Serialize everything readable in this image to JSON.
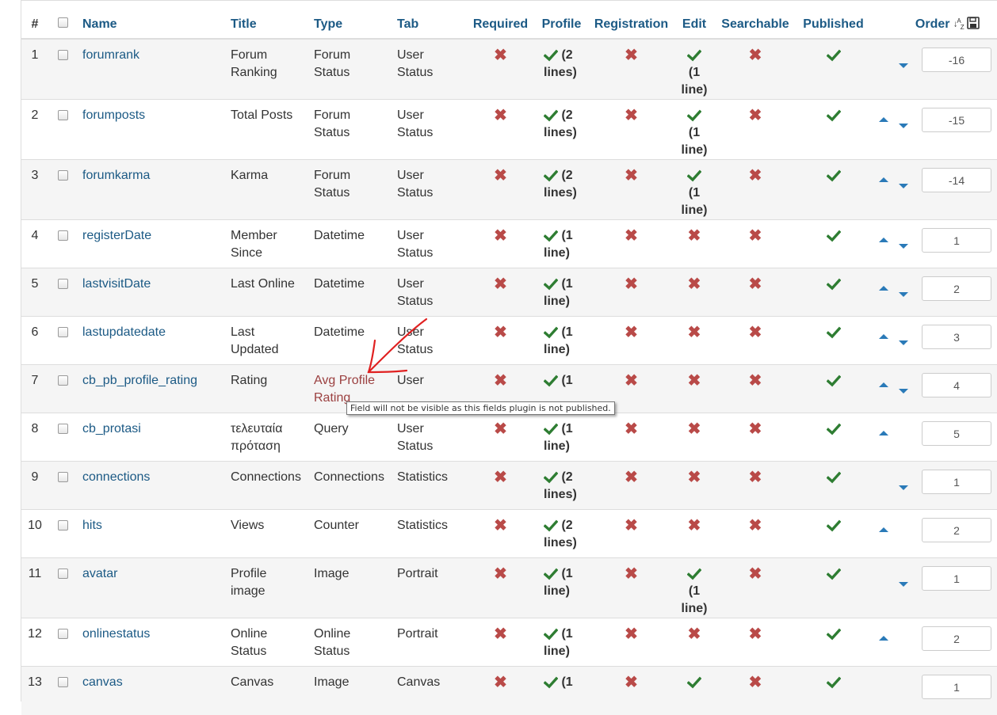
{
  "header": {
    "num": "#",
    "name": "Name",
    "title": "Title",
    "type": "Type",
    "tab": "Tab",
    "required": "Required",
    "profile": "Profile",
    "registration": "Registration",
    "edit": "Edit",
    "searchable": "Searchable",
    "published": "Published",
    "order": "Order",
    "sort_icon": "↓A-Z",
    "save_icon": "save-icon"
  },
  "rows": [
    {
      "num": "1",
      "name": "forumrank",
      "title": "Forum Ranking",
      "type": "Forum Status",
      "tab": "User Status",
      "required": false,
      "profile": "(2 lines)",
      "registration": false,
      "edit": "(1 line)",
      "searchable": false,
      "published": true,
      "up": false,
      "down": true,
      "order": "-16"
    },
    {
      "num": "2",
      "name": "forumposts",
      "title": "Total Posts",
      "type": "Forum Status",
      "tab": "User Status",
      "required": false,
      "profile": "(2 lines)",
      "registration": false,
      "edit": "(1 line)",
      "searchable": false,
      "published": true,
      "up": true,
      "down": true,
      "order": "-15"
    },
    {
      "num": "3",
      "name": "forumkarma",
      "title": "Karma",
      "type": "Forum Status",
      "tab": "User Status",
      "required": false,
      "profile": "(2 lines)",
      "registration": false,
      "edit": "(1 line)",
      "searchable": false,
      "published": true,
      "up": true,
      "down": true,
      "order": "-14"
    },
    {
      "num": "4",
      "name": "registerDate",
      "title": "Member Since",
      "type": "Datetime",
      "tab": "User Status",
      "required": false,
      "profile": "(1 line)",
      "registration": false,
      "edit": "",
      "searchable": false,
      "published": true,
      "up": true,
      "down": true,
      "order": "1"
    },
    {
      "num": "5",
      "name": "lastvisitDate",
      "title": "Last Online",
      "type": "Datetime",
      "tab": "User Status",
      "required": false,
      "profile": "(1 line)",
      "registration": false,
      "edit": "",
      "searchable": false,
      "published": true,
      "up": true,
      "down": true,
      "order": "2"
    },
    {
      "num": "6",
      "name": "lastupdatedate",
      "title": "Last Updated",
      "type": "Datetime",
      "tab": "User Status",
      "required": false,
      "profile": "(1 line)",
      "registration": false,
      "edit": "",
      "searchable": false,
      "published": true,
      "up": true,
      "down": true,
      "order": "3"
    },
    {
      "num": "7",
      "name": "cb_pb_profile_rating",
      "title": "Rating",
      "type": "Avg Profile Rating",
      "type_warn": true,
      "tab": "User",
      "required": false,
      "profile": "(1",
      "registration": false,
      "edit": "",
      "searchable": false,
      "published": true,
      "up": true,
      "down": true,
      "order": "4"
    },
    {
      "num": "8",
      "name": "cb_protasi",
      "title": "τελευταία πρόταση",
      "type": "Query",
      "tab": "User Status",
      "required": false,
      "profile": "(1 line)",
      "registration": false,
      "edit": "",
      "searchable": false,
      "published": true,
      "up": true,
      "down": false,
      "order": "5"
    },
    {
      "num": "9",
      "name": "connections",
      "title": "Connections",
      "type": "Connections",
      "tab": "Statistics",
      "required": false,
      "profile": "(2 lines)",
      "registration": false,
      "edit": "",
      "searchable": false,
      "published": true,
      "up": false,
      "down": true,
      "order": "1"
    },
    {
      "num": "10",
      "name": "hits",
      "title": "Views",
      "type": "Counter",
      "tab": "Statistics",
      "required": false,
      "profile": "(2 lines)",
      "registration": false,
      "edit": "",
      "searchable": false,
      "published": true,
      "up": true,
      "down": false,
      "order": "2"
    },
    {
      "num": "11",
      "name": "avatar",
      "title": "Profile image",
      "type": "Image",
      "tab": "Portrait",
      "required": false,
      "profile": "(1 line)",
      "registration": false,
      "edit": "(1 line)",
      "searchable": false,
      "published": true,
      "up": false,
      "down": true,
      "order": "1"
    },
    {
      "num": "12",
      "name": "onlinestatus",
      "title": "Online Status",
      "type": "Online Status",
      "tab": "Portrait",
      "required": false,
      "profile": "(1 line)",
      "registration": false,
      "edit": "",
      "searchable": false,
      "published": true,
      "up": true,
      "down": false,
      "order": "2"
    },
    {
      "num": "13",
      "name": "canvas",
      "title": "Canvas",
      "type": "Image",
      "tab": "Canvas",
      "required": false,
      "profile": "(1",
      "registration": false,
      "edit": "",
      "edit_check": true,
      "searchable": false,
      "published": true,
      "up": false,
      "down": false,
      "order": "1"
    }
  ],
  "tooltip": "Field will not be visible as this fields plugin is not published.",
  "colors": {
    "link": "#1c5a85",
    "check": "#2e7d32",
    "cross": "#b94a48",
    "arrow": "#2a7ab8",
    "annotation": "#e02020"
  }
}
